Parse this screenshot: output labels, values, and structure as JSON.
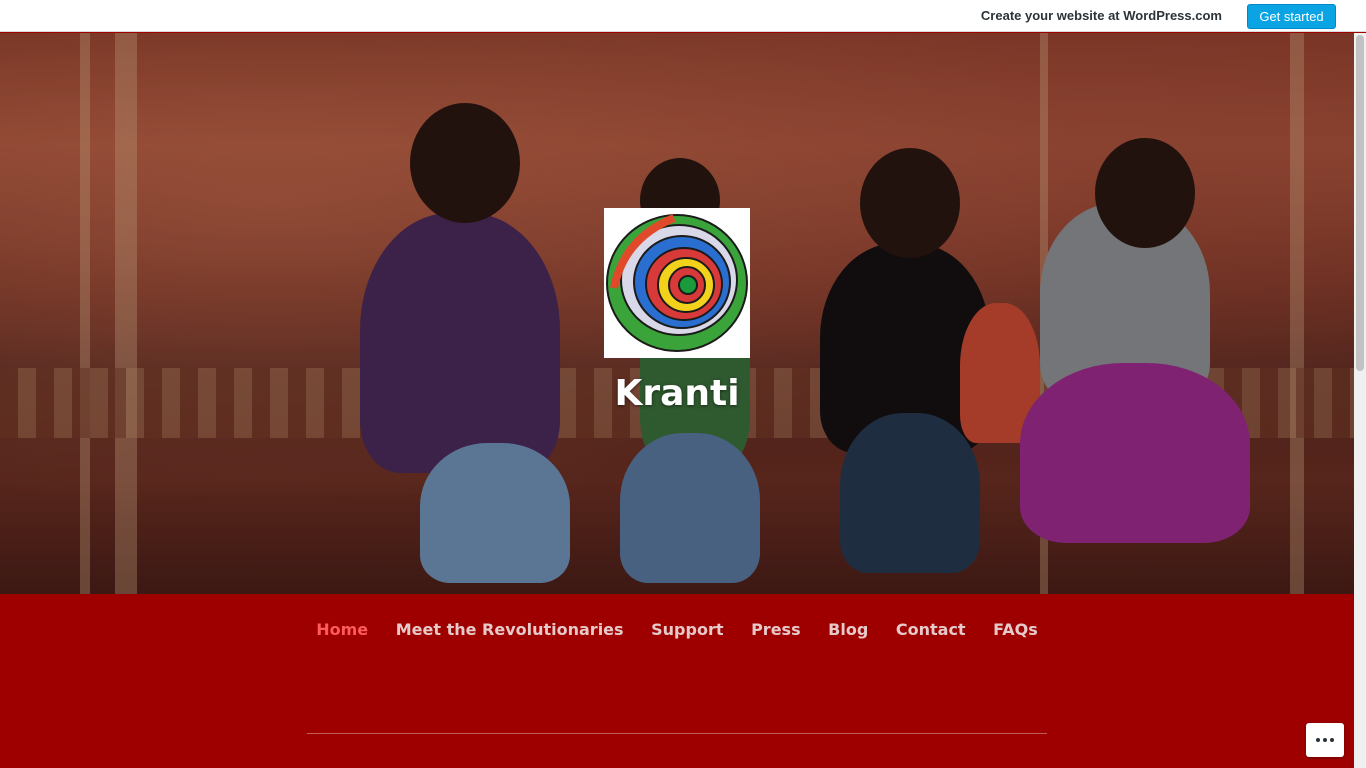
{
  "wp_bar": {
    "cta_text": "Create your website at WordPress.com",
    "button_label": "Get started",
    "button_color": "#0aa3e3"
  },
  "site": {
    "title": "Kranti",
    "logo_icon": "spiral-logo-icon"
  },
  "nav": {
    "items": [
      {
        "label": "Home",
        "active": true
      },
      {
        "label": "Meet the Revolutionaries",
        "active": false
      },
      {
        "label": "Support",
        "active": false
      },
      {
        "label": "Press",
        "active": false
      },
      {
        "label": "Blog",
        "active": false
      },
      {
        "label": "Contact",
        "active": false
      },
      {
        "label": "FAQs",
        "active": false
      }
    ],
    "active_color": "#ff5b5b",
    "text_color": "#e6c9c9",
    "background_color": "#9e0000"
  },
  "more_button_icon": "ellipsis-icon"
}
